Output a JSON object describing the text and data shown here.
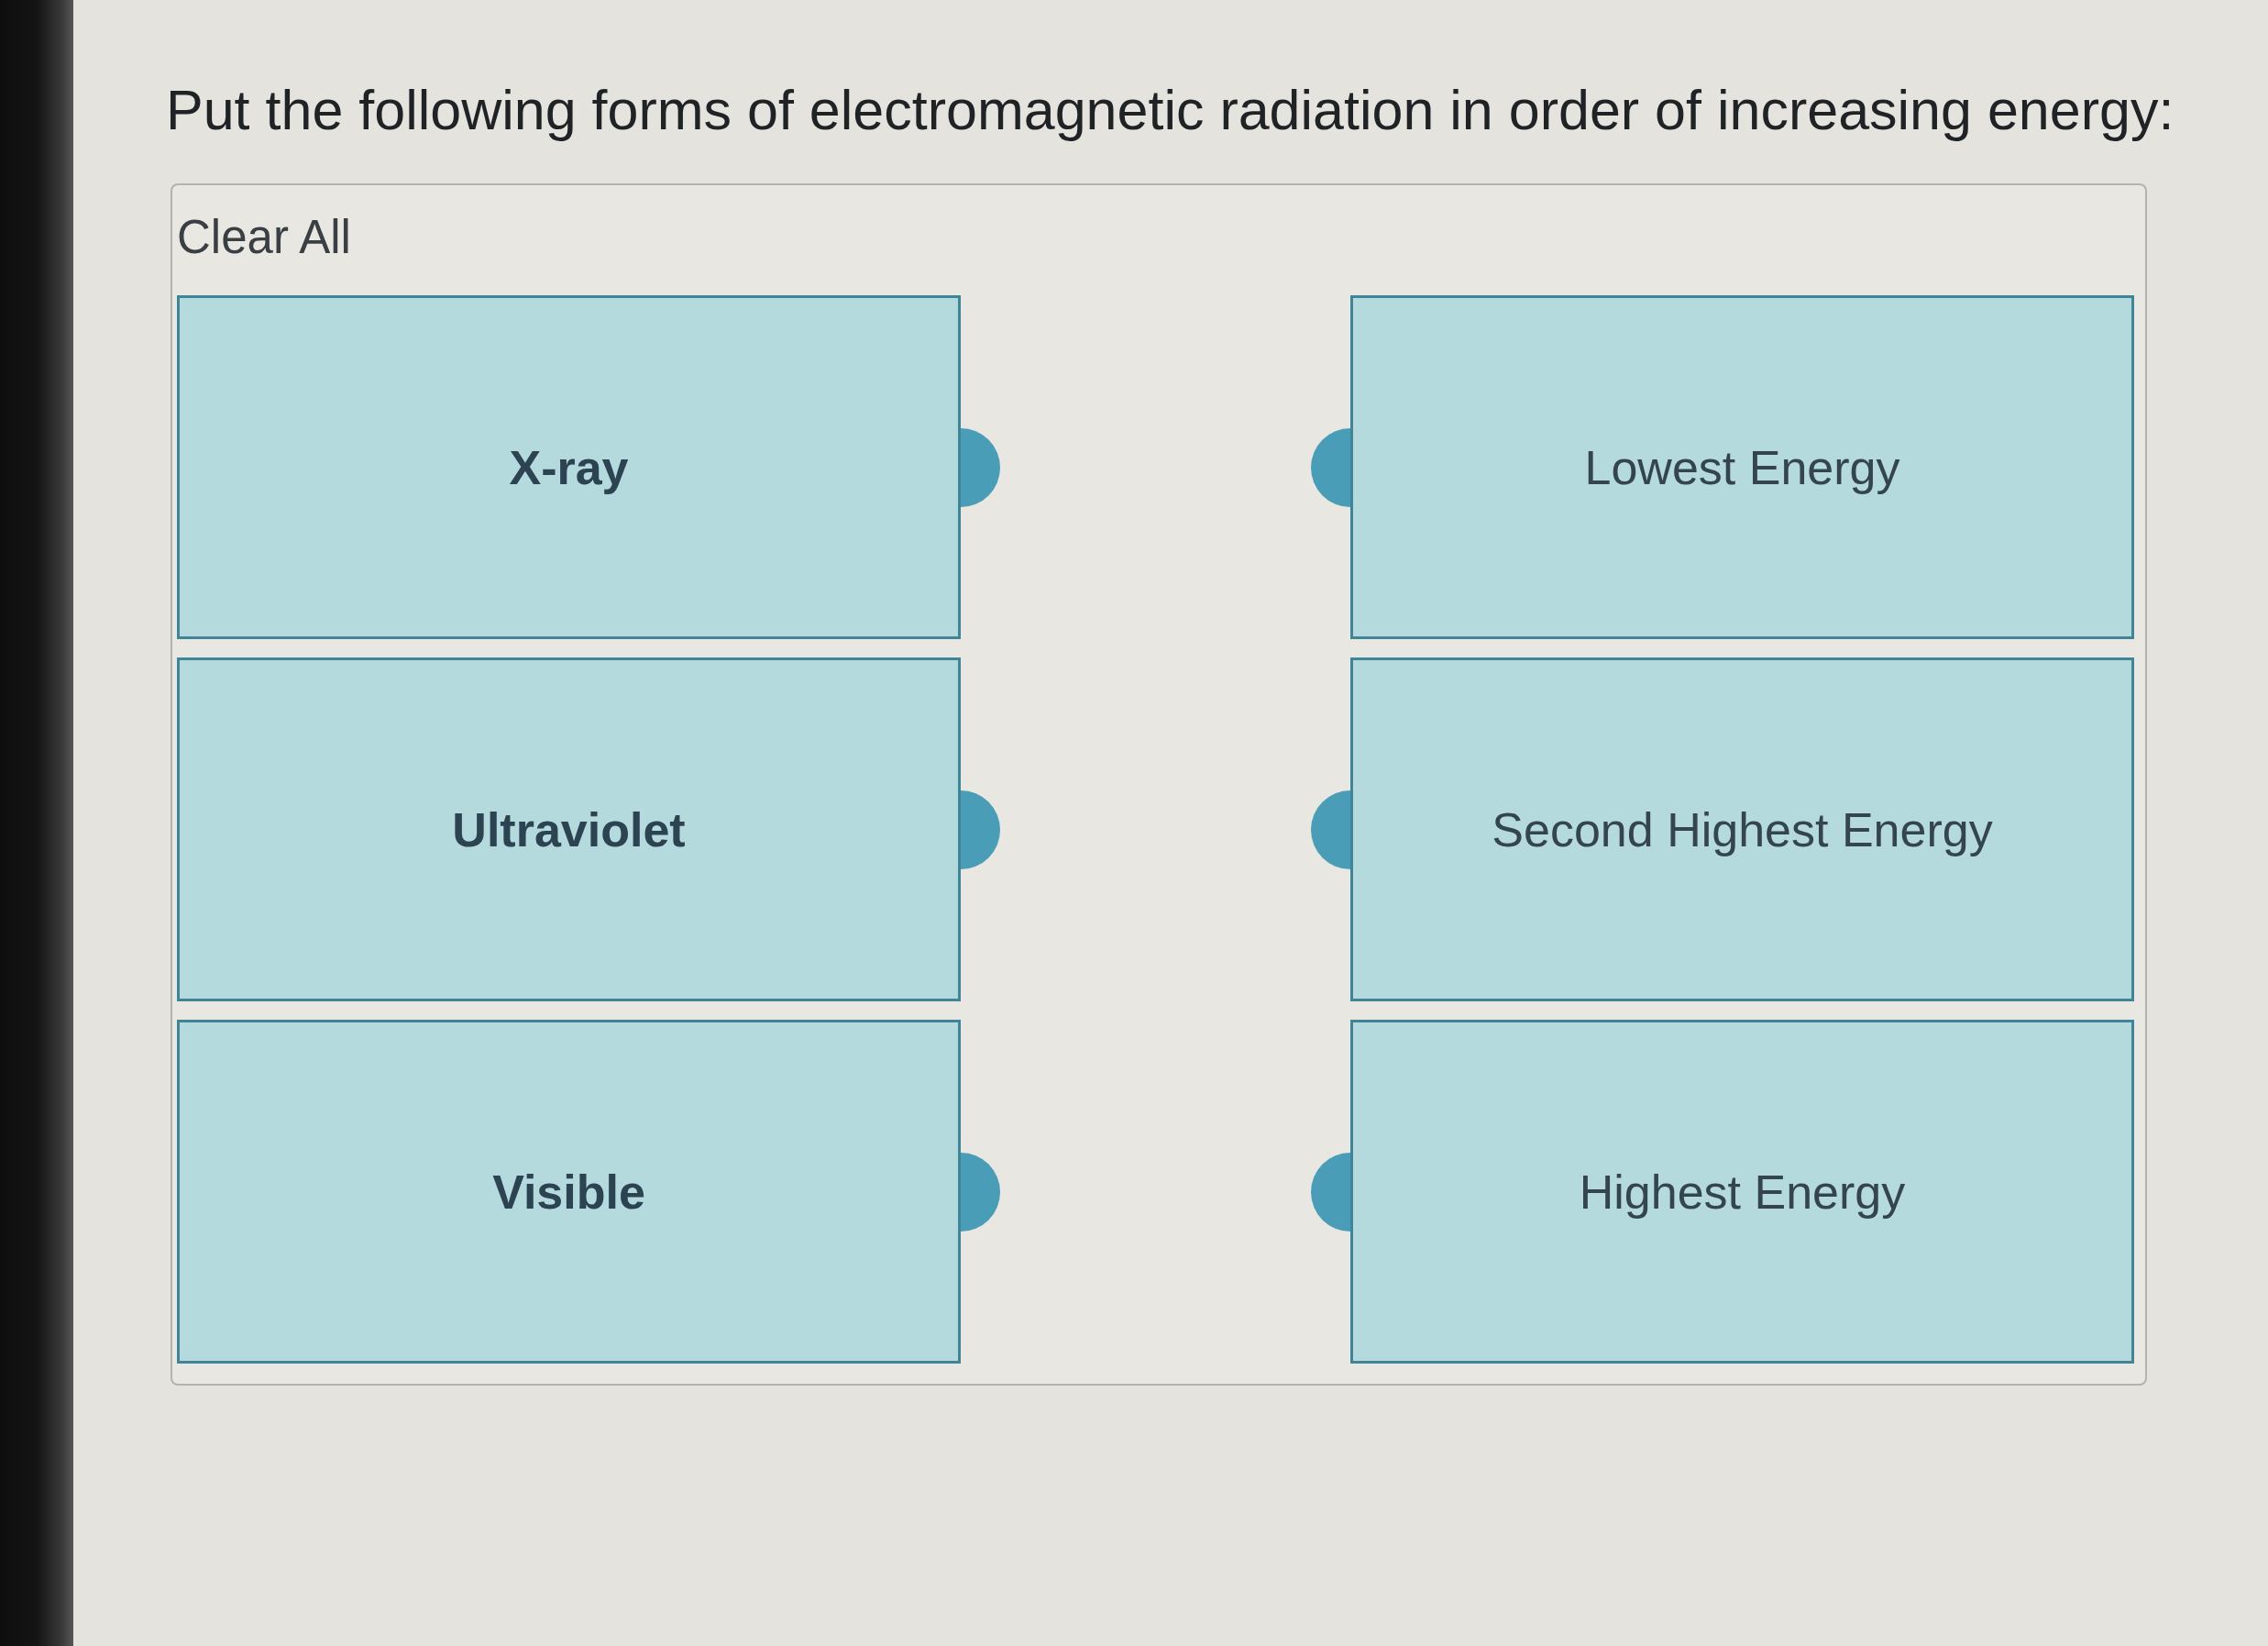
{
  "question": {
    "text": "Put the following forms of electromagnetic radiation in order of increasing energy:"
  },
  "clear_all": {
    "label": "Clear All"
  },
  "items": [
    {
      "label": "X-ray"
    },
    {
      "label": "Ultraviolet"
    },
    {
      "label": "Visible"
    }
  ],
  "targets": [
    {
      "label": "Lowest Energy"
    },
    {
      "label": "Second Highest Energy"
    },
    {
      "label": "Highest Energy"
    }
  ]
}
